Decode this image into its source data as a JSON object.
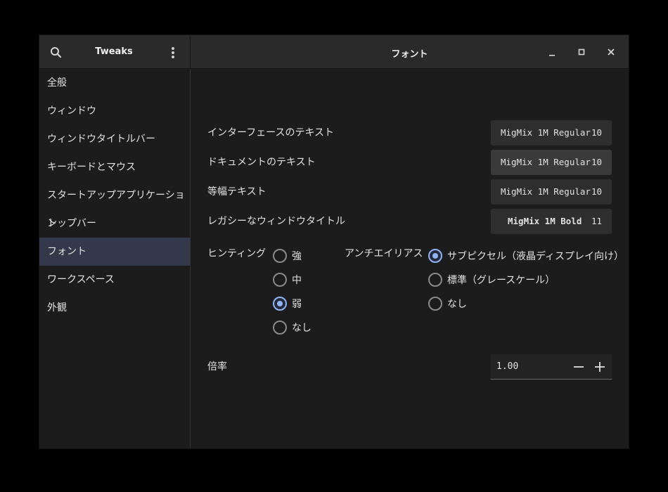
{
  "header": {
    "app_title": "Tweaks",
    "page_title": "フォント",
    "icons": {
      "search": "search-icon",
      "menu": "vertical-dots-icon",
      "minimize": "minimize-icon",
      "maximize": "maximize-icon",
      "close": "close-icon"
    }
  },
  "sidebar": {
    "items": [
      {
        "label": "全般"
      },
      {
        "label": "ウィンドウ"
      },
      {
        "label": "ウィンドウタイトルバー"
      },
      {
        "label": "キーボードとマウス"
      },
      {
        "label": "スタートアップアプリケーション"
      },
      {
        "label": "トップバー"
      },
      {
        "label": "フォント",
        "selected": true
      },
      {
        "label": "ワークスペース"
      },
      {
        "label": "外観"
      }
    ]
  },
  "fonts": {
    "interface": {
      "label": "インターフェースのテキスト",
      "font": "MigMix 1M Regular",
      "size": "10"
    },
    "document": {
      "label": "ドキュメントのテキスト",
      "font": "MigMix 1M Regular",
      "size": "10"
    },
    "monospace": {
      "label": "等幅テキスト",
      "font": "MigMix 1M Regular",
      "size": "10"
    },
    "legacy_title": {
      "label": "レガシーなウィンドウタイトル",
      "font": "MigMix 1M Bold",
      "size": "11"
    }
  },
  "hinting": {
    "label": "ヒンティング",
    "options": [
      {
        "label": "強",
        "checked": false
      },
      {
        "label": "中",
        "checked": false
      },
      {
        "label": "弱",
        "checked": true
      },
      {
        "label": "なし",
        "checked": false
      }
    ]
  },
  "antialiasing": {
    "label": "アンチエイリアス",
    "options": [
      {
        "label": "サブピクセル（液晶ディスプレイ向け）",
        "checked": true
      },
      {
        "label": "標準（グレースケール）",
        "checked": false
      },
      {
        "label": "なし",
        "checked": false
      }
    ]
  },
  "scaling": {
    "label": "倍率",
    "value": "1.00",
    "icons": {
      "decrement": "minus-icon",
      "increment": "plus-icon"
    }
  },
  "colors": {
    "accent": "#8fb4f5",
    "sidebar_selected": "#33394a",
    "background": "#1c1c1c",
    "header": "#2a2a2a"
  }
}
